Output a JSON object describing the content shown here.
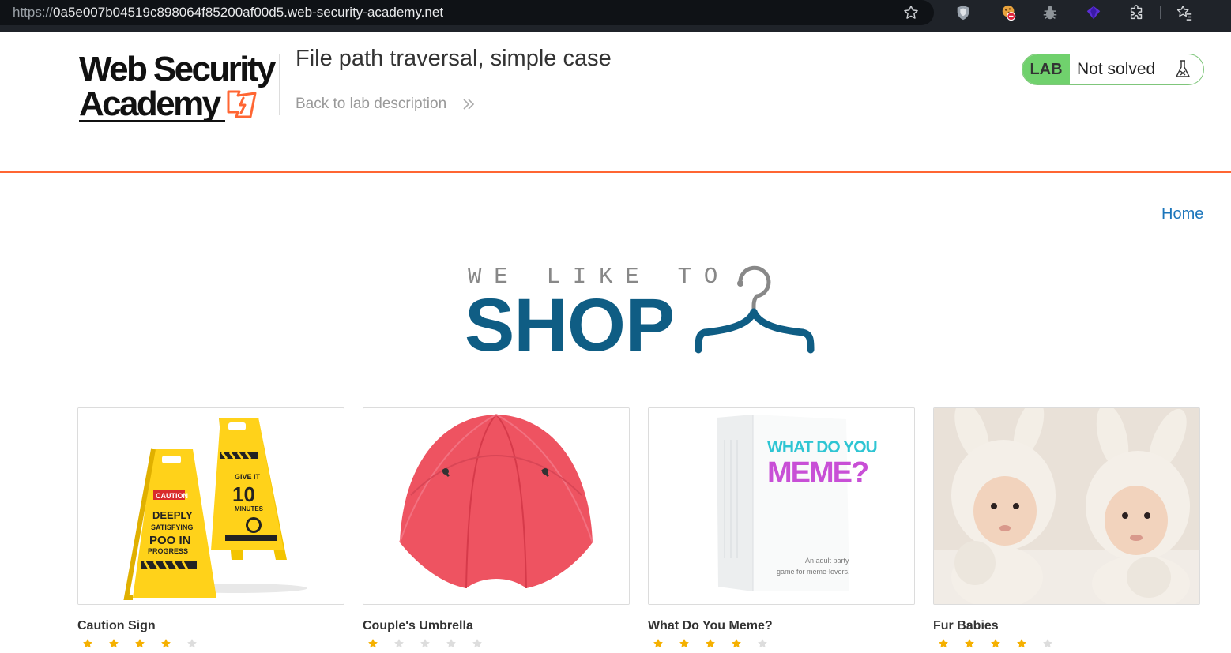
{
  "browser": {
    "url_scheme": "https://",
    "url_host": "0a5e007b04519c898064f85200af00d5.web-security-academy.net",
    "icons": [
      "star-icon",
      "shield-extension-icon",
      "cookie-blocker-extension-icon",
      "bug-extension-icon",
      "purple-gem-extension-icon",
      "puzzle-extensions-icon",
      "favorites-icon"
    ]
  },
  "header": {
    "logo_line1": "Web Security",
    "logo_line2": "Academy",
    "lab_title": "File path traversal, simple case",
    "back_link": "Back to lab description",
    "lab_badge": "LAB",
    "lab_status": "Not solved"
  },
  "nav": {
    "home": "Home"
  },
  "banner": {
    "small": "WE LIKE TO",
    "big": "SHOP"
  },
  "products": [
    {
      "name": "Caution Sign",
      "rating": 4,
      "image": "caution-sign"
    },
    {
      "name": "Couple's Umbrella",
      "rating": 1,
      "image": "umbrella"
    },
    {
      "name": "What Do You Meme?",
      "rating": 4,
      "image": "meme-game-box",
      "box_line1": "WHAT DO YOU",
      "box_line2": "MEME?",
      "box_tagline1": "An adult party",
      "box_tagline2": "game for meme-lovers."
    },
    {
      "name": "Fur Babies",
      "rating": 4,
      "image": "babies-bunny-costumes"
    }
  ],
  "colors": {
    "accent_orange": "#ff6633",
    "lab_green": "#70d16d",
    "shop_blue": "#0f5d84",
    "link_blue": "#1b75bb",
    "star_gold": "#f5b000"
  }
}
